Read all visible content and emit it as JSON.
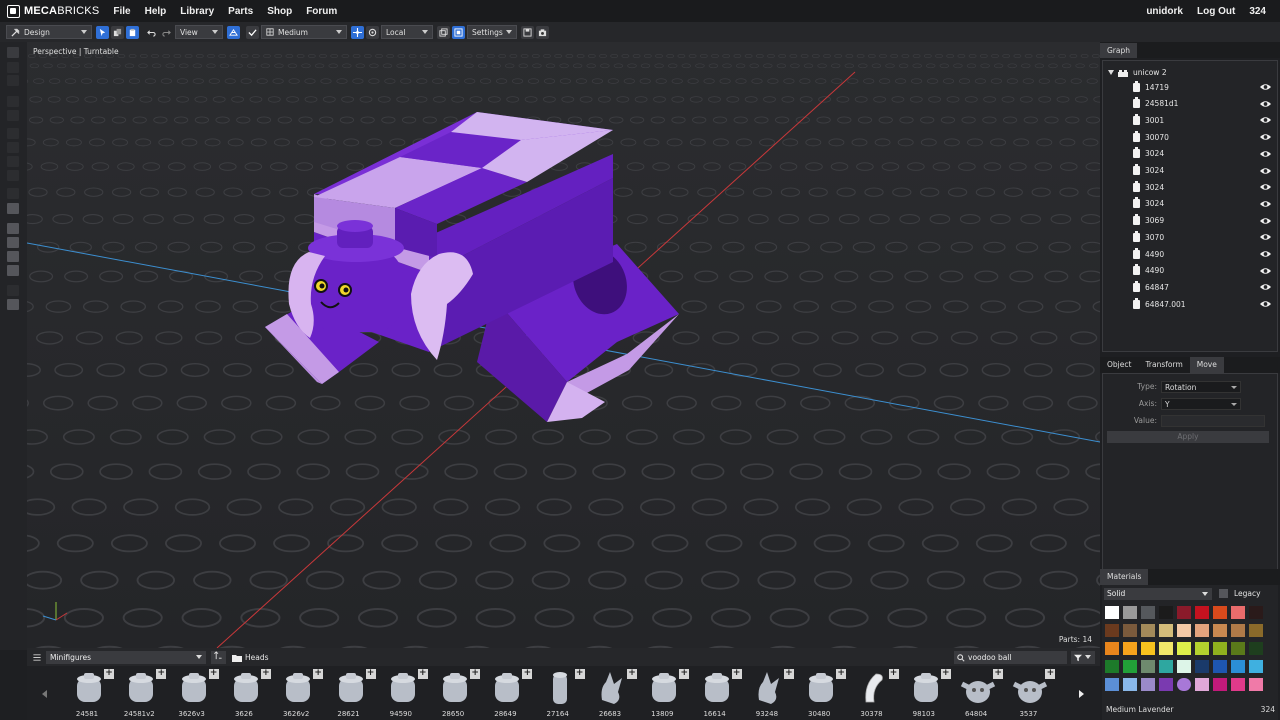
{
  "app": {
    "logo_text_bold": "MECA",
    "logo_text": "BRICKS",
    "menu": [
      "File",
      "Help",
      "Library",
      "Parts",
      "Shop",
      "Forum"
    ],
    "user": "unidork",
    "logout": "Log Out",
    "count": "324"
  },
  "toolbar": {
    "mode": "Design",
    "view": "View",
    "quality": "Medium",
    "space": "Local",
    "settings": "Settings"
  },
  "viewport": {
    "label": "Perspective | Turntable",
    "parts_count": "Parts: 14"
  },
  "graph": {
    "tab": "Graph",
    "root": "unicow 2",
    "items": [
      "14719",
      "24581d1",
      "3001",
      "30070",
      "3024",
      "3024",
      "3024",
      "3024",
      "3069",
      "3070",
      "4490",
      "4490",
      "64847",
      "64847.001"
    ]
  },
  "props": {
    "tabs": [
      "Object",
      "Transform",
      "Move"
    ],
    "active_tab": "Move",
    "type_label": "Type:",
    "type_value": "Rotation",
    "axis_label": "Axis:",
    "axis_value": "Y",
    "value_label": "Value:",
    "apply": "Apply"
  },
  "materials": {
    "tab": "Materials",
    "mode": "Solid",
    "legacy": "Legacy",
    "selected_name": "Medium Lavender",
    "selected_code": "324",
    "swatches": [
      "#ffffff",
      "#9a9a9a",
      "#55585c",
      "#1b1b1b",
      "#8a1a2a",
      "#c4121f",
      "#d84a1c",
      "#e96c6c",
      "#2a1a1a",
      "#6b3a1e",
      "#7a5a3c",
      "#a38a5a",
      "#d4bc7a",
      "#f5c9a6",
      "#e4a37d",
      "#c98850",
      "#b07a48",
      "#8a6a2a",
      "#e8851c",
      "#f5a31c",
      "#f7c31e",
      "#f2e86a",
      "#ddf04a",
      "#b4d22e",
      "#8fb01e",
      "#5a7a1a",
      "#1e3e1e",
      "#1d7a2a",
      "#22a038",
      "#6e8a6e",
      "#2ea7a0",
      "#ddf5e8",
      "#1a3a6a",
      "#1e56b0",
      "#2b8fd6",
      "#3fb0e0",
      "#5b8fd6",
      "#8ab8e8",
      "#9a8ac8",
      "#7a3ab0",
      "#a878d8",
      "#e0a8d8",
      "#c21a7a",
      "#e03a8a",
      "#f07aa8"
    ]
  },
  "bottom": {
    "category": "Minifigures",
    "folder": "Heads",
    "search": "voodoo ball",
    "parts": [
      "24581",
      "24581v2",
      "3626v3",
      "3626",
      "3626v2",
      "28621",
      "94590",
      "28650",
      "28649",
      "27164",
      "26683",
      "13809",
      "16614",
      "93248",
      "30480",
      "30378",
      "98103",
      "64804",
      "3537"
    ]
  }
}
